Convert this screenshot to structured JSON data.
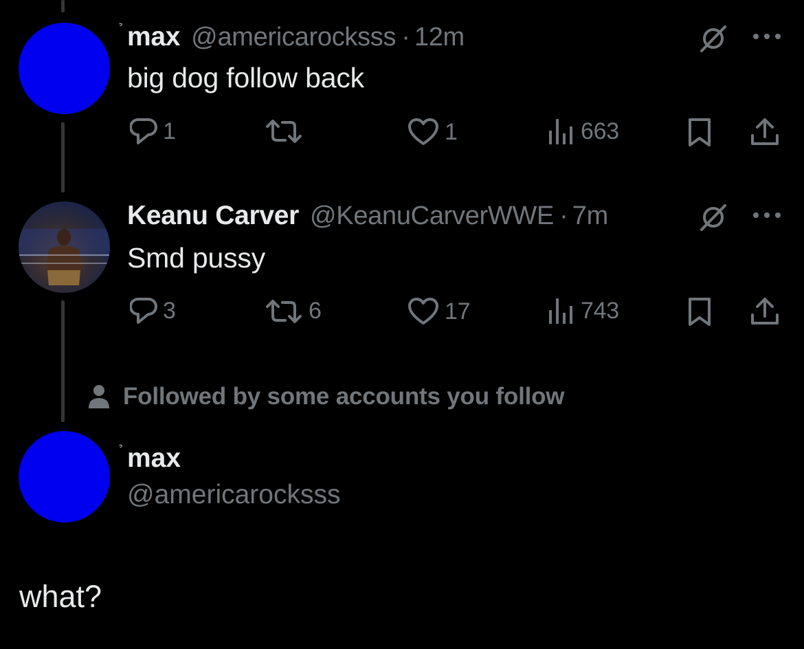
{
  "colors": {
    "background": "#000000",
    "text": "#e7e9ea",
    "muted": "#71767b",
    "avatar_blue": "#0000f0"
  },
  "tweets": [
    {
      "avatar": "blue-avatar",
      "name": "max",
      "handle": "@americarocksss",
      "separator": "·",
      "time": "12m",
      "text": "big dog follow back",
      "actions": {
        "replies": "1",
        "reposts": "",
        "likes": "1",
        "views": "663"
      },
      "icons": [
        "grok-icon",
        "more-icon",
        "reply-icon",
        "repost-icon",
        "like-icon",
        "views-icon",
        "bookmark-icon",
        "share-icon"
      ]
    },
    {
      "avatar": "wrestler-photo-avatar",
      "name": "Keanu Carver",
      "handle": "@KeanuCarverWWE",
      "separator": "·",
      "time": "7m",
      "text": "Smd pussy",
      "actions": {
        "replies": "3",
        "reposts": "6",
        "likes": "17",
        "views": "743"
      },
      "icons": [
        "grok-icon",
        "more-icon",
        "reply-icon",
        "repost-icon",
        "like-icon",
        "views-icon",
        "bookmark-icon",
        "share-icon"
      ]
    }
  ],
  "social_context": {
    "icon": "person-icon",
    "text": "Followed by some accounts you follow"
  },
  "profile_card": {
    "name": "max",
    "handle": "@americarocksss"
  },
  "reply_text": "what?"
}
